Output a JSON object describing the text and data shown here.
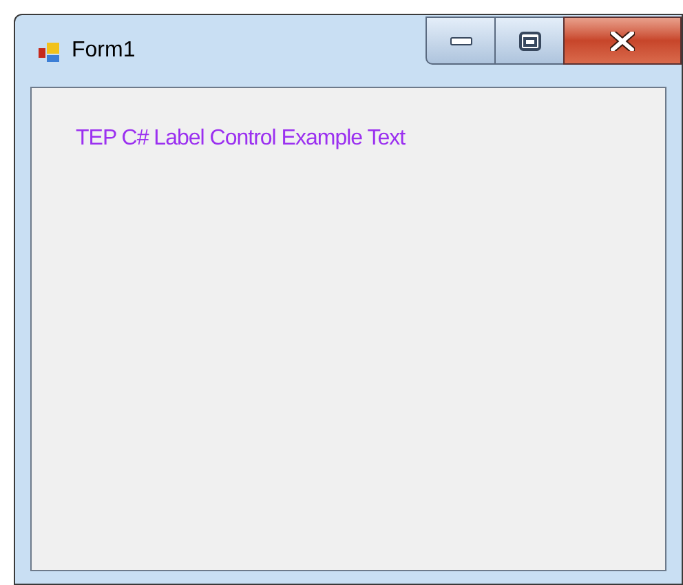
{
  "window": {
    "title": "Form1"
  },
  "label": {
    "text": "TEP C# Label Control Example Text"
  }
}
